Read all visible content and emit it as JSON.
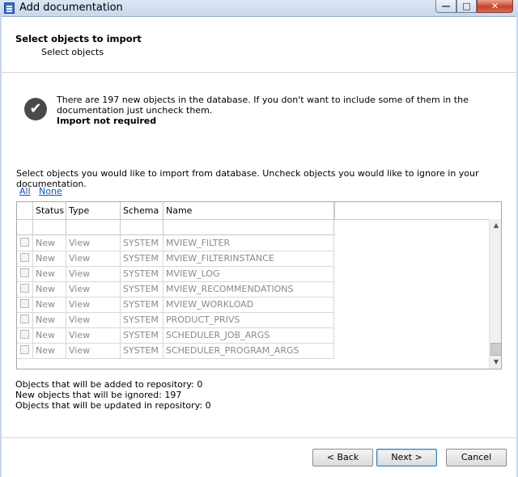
{
  "window": {
    "title": "Add documentation",
    "controls": {
      "minimize": "—",
      "maximize": "□",
      "close": "✕"
    }
  },
  "header": {
    "title": "Select objects to import",
    "subtitle": "Select objects"
  },
  "info": {
    "icon": "check-circle-icon",
    "message": "There are 197 new objects in the database. If you don't want to include some of them in the documentation just uncheck them.",
    "status": "Import not required"
  },
  "instruction": "Select objects you would like to import from database. Uncheck objects you would like to ignore in your documentation.",
  "links": {
    "all": "All",
    "none": "None"
  },
  "table": {
    "columns": [
      "",
      "Status",
      "Type",
      "Schema",
      "Name"
    ],
    "rows": [
      {
        "checked": false,
        "status": "New",
        "type": "View",
        "schema": "SYSTEM",
        "name": "MVIEW_FILTER"
      },
      {
        "checked": false,
        "status": "New",
        "type": "View",
        "schema": "SYSTEM",
        "name": "MVIEW_FILTERINSTANCE"
      },
      {
        "checked": false,
        "status": "New",
        "type": "View",
        "schema": "SYSTEM",
        "name": "MVIEW_LOG"
      },
      {
        "checked": false,
        "status": "New",
        "type": "View",
        "schema": "SYSTEM",
        "name": "MVIEW_RECOMMENDATIONS"
      },
      {
        "checked": false,
        "status": "New",
        "type": "View",
        "schema": "SYSTEM",
        "name": "MVIEW_WORKLOAD"
      },
      {
        "checked": false,
        "status": "New",
        "type": "View",
        "schema": "SYSTEM",
        "name": "PRODUCT_PRIVS"
      },
      {
        "checked": false,
        "status": "New",
        "type": "View",
        "schema": "SYSTEM",
        "name": "SCHEDULER_JOB_ARGS"
      },
      {
        "checked": false,
        "status": "New",
        "type": "View",
        "schema": "SYSTEM",
        "name": "SCHEDULER_PROGRAM_ARGS"
      }
    ],
    "scrollbar": {
      "up": "▲",
      "down": "▼"
    }
  },
  "stats": {
    "added": "Objects that will be added to repository: 0",
    "ignored": "New objects that will be ignored: 197",
    "updated": "Objects that will be updated in repository: 0"
  },
  "buttons": {
    "back": "< Back",
    "next": "Next >",
    "cancel": "Cancel"
  }
}
